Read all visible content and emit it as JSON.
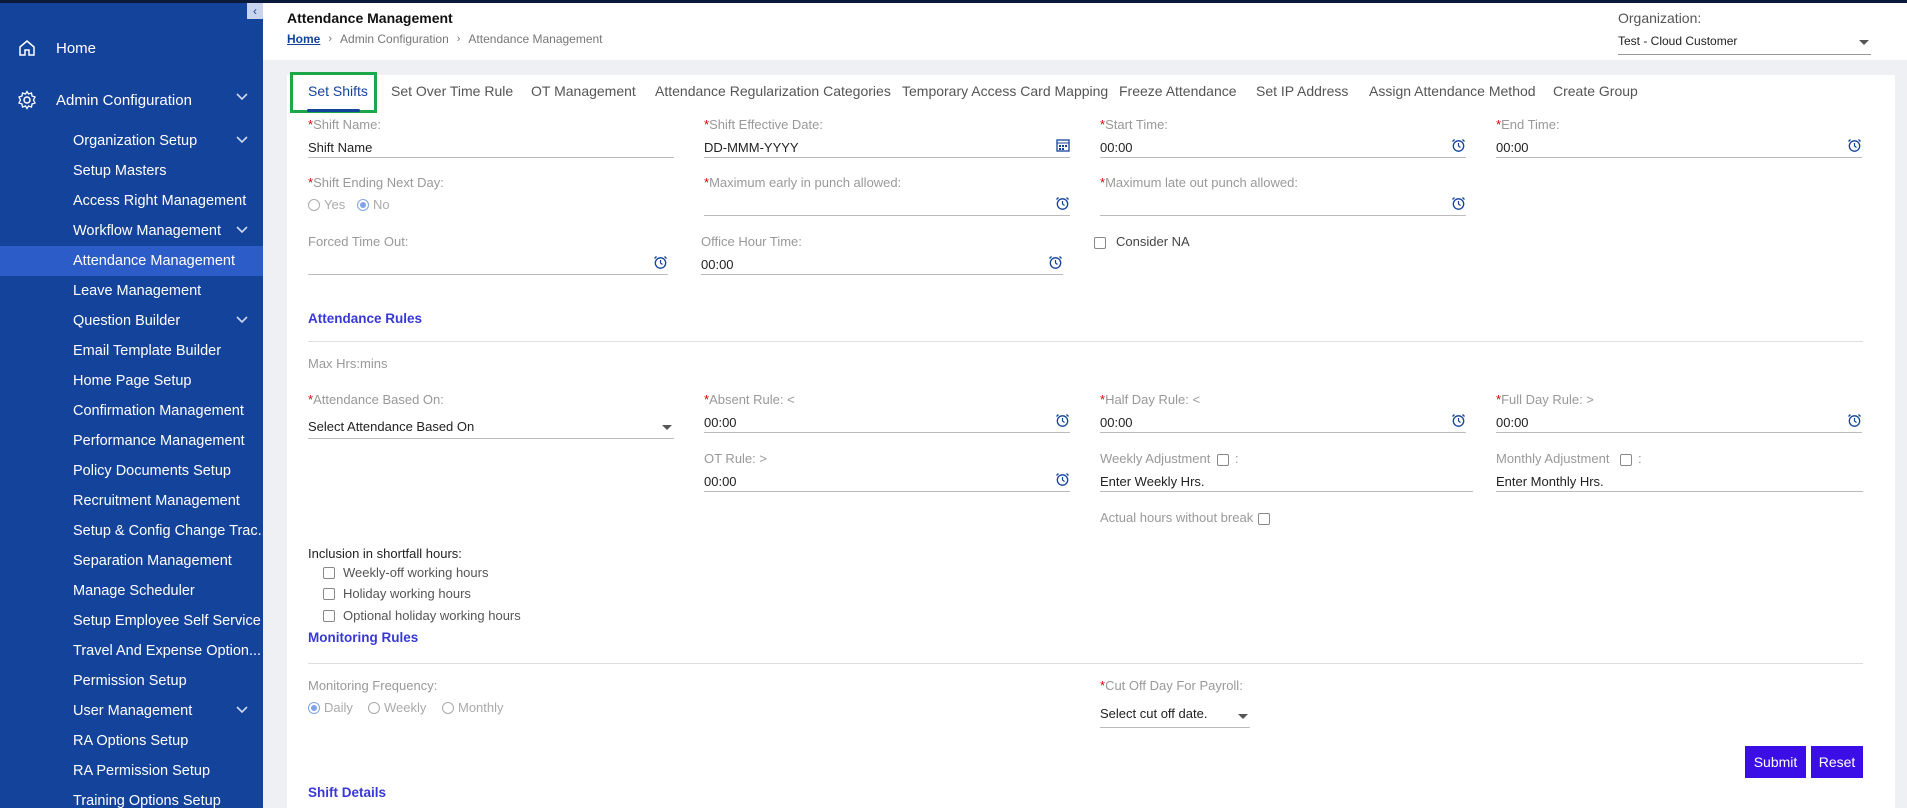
{
  "sidebar": {
    "collapse_glyph": "‹",
    "top": [
      {
        "label": "Home",
        "icon": "home-icon"
      },
      {
        "label": "Admin Configuration",
        "icon": "gear-icon"
      }
    ],
    "items": [
      {
        "label": "Organization Setup",
        "expandable": true
      },
      {
        "label": "Setup Masters"
      },
      {
        "label": "Access Right Management"
      },
      {
        "label": "Workflow Management",
        "expandable": true
      },
      {
        "label": "Attendance Management",
        "active": true
      },
      {
        "label": "Leave Management"
      },
      {
        "label": "Question Builder",
        "expandable": true
      },
      {
        "label": "Email Template Builder"
      },
      {
        "label": "Home Page Setup"
      },
      {
        "label": "Confirmation Management"
      },
      {
        "label": "Performance Management"
      },
      {
        "label": "Policy Documents Setup"
      },
      {
        "label": "Recruitment Management"
      },
      {
        "label": "Setup & Config Change Trac..."
      },
      {
        "label": "Separation Management"
      },
      {
        "label": "Manage Scheduler"
      },
      {
        "label": "Setup Employee Self Service"
      },
      {
        "label": "Travel And Expense Option..."
      },
      {
        "label": "Permission Setup"
      },
      {
        "label": "User Management",
        "expandable": true
      },
      {
        "label": "RA Options Setup"
      },
      {
        "label": "RA Permission Setup"
      },
      {
        "label": "Training Options Setup"
      }
    ]
  },
  "header": {
    "title": "Attendance Management",
    "breadcrumb": [
      "Home",
      "Admin Configuration",
      "Attendance Management"
    ],
    "org_label": "Organization:",
    "org_value": "Test - Cloud Customer"
  },
  "tabs": [
    "Set Shifts",
    "Set Over Time Rule",
    "OT Management",
    "Attendance Regularization Categories",
    "Temporary Access Card Mapping",
    "Freeze Attendance",
    "Set IP Address",
    "Assign Attendance Method",
    "Create Group"
  ],
  "form": {
    "required_mark": "*",
    "shift_name": {
      "label": "Shift Name:",
      "value": "Shift Name"
    },
    "effective_date": {
      "label": "Shift Effective Date:",
      "value": "DD-MMM-YYYY"
    },
    "start_time": {
      "label": "Start Time:",
      "value": "00:00"
    },
    "end_time": {
      "label": "End Time:",
      "value": "00:00"
    },
    "ending_next_day": {
      "label": "Shift Ending Next Day:",
      "yes": "Yes",
      "no": "No"
    },
    "max_early": {
      "label": "Maximum early in punch allowed:",
      "value": ""
    },
    "max_late": {
      "label": "Maximum late out punch allowed:",
      "value": ""
    },
    "forced_timeout": {
      "label": "Forced Time Out:",
      "value": ""
    },
    "office_hour": {
      "label": "Office Hour Time:",
      "value": "00:00"
    },
    "consider_na": "Consider NA"
  },
  "attendance_rules": {
    "title": "Attendance Rules",
    "max_hrs": "Max Hrs:mins",
    "based_on": {
      "label": "Attendance Based On:",
      "value": "Select Attendance Based On"
    },
    "absent_rule": {
      "label": "Absent Rule: <",
      "value": "00:00"
    },
    "half_day_rule": {
      "label": "Half Day Rule: <",
      "value": "00:00"
    },
    "full_day_rule": {
      "label": "Full Day Rule: >",
      "value": "00:00"
    },
    "ot_rule": {
      "label": "OT Rule: >",
      "value": "00:00"
    },
    "weekly_adj": {
      "label": "Weekly Adjustment",
      "suffix": ":",
      "value": "Enter Weekly Hrs."
    },
    "monthly_adj": {
      "label": "Monthly Adjustment",
      "suffix": ":",
      "value": "Enter Monthly Hrs."
    },
    "actual_hours": "Actual hours without break",
    "shortfall_title": "Inclusion in shortfall hours:",
    "shortfall": [
      "Weekly-off working hours",
      "Holiday working hours",
      "Optional holiday working hours"
    ]
  },
  "monitoring_rules": {
    "title": "Monitoring Rules",
    "frequency_label": "Monitoring Frequency:",
    "frequency_options": [
      "Daily",
      "Weekly",
      "Monthly"
    ],
    "cutoff": {
      "label": "Cut Off Day For Payroll:",
      "value": "Select cut off date."
    }
  },
  "buttons": {
    "submit": "Submit",
    "reset": "Reset"
  },
  "shift_details_title": "Shift Details",
  "colors": {
    "sidebar": "#14439c",
    "active_nav": "#2b5cc7",
    "accent": "#3b0ee8",
    "section_title": "#3838d6",
    "highlight": "#1fa64a"
  }
}
